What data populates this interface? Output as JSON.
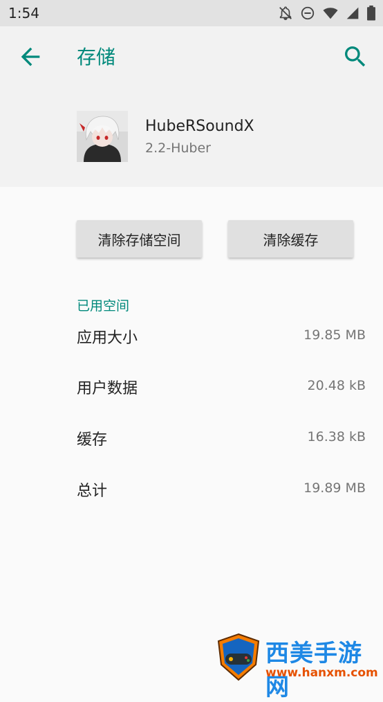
{
  "status_bar": {
    "time": "1:54"
  },
  "toolbar": {
    "title": "存储"
  },
  "app": {
    "name": "HubeRSoundX",
    "version": "2.2-Huber"
  },
  "buttons": {
    "clear_storage": "清除存储空间",
    "clear_cache": "清除缓存"
  },
  "storage": {
    "section_title": "已用空间",
    "rows": [
      {
        "label": "应用大小",
        "value": "19.85 MB"
      },
      {
        "label": "用户数据",
        "value": "20.48 kB"
      },
      {
        "label": "缓存",
        "value": "16.38 kB"
      },
      {
        "label": "总计",
        "value": "19.89 MB"
      }
    ]
  },
  "watermark": {
    "title": "西美手游网",
    "url": "www.hanxm.com"
  },
  "colors": {
    "accent": "#00897b",
    "status_bar": "#e2e2e2",
    "background": "#fafafa"
  },
  "icons": [
    "notifications-off-icon",
    "do-not-disturb-icon",
    "wifi-icon",
    "signal-icon",
    "battery-icon",
    "back-arrow-icon",
    "search-icon"
  ]
}
